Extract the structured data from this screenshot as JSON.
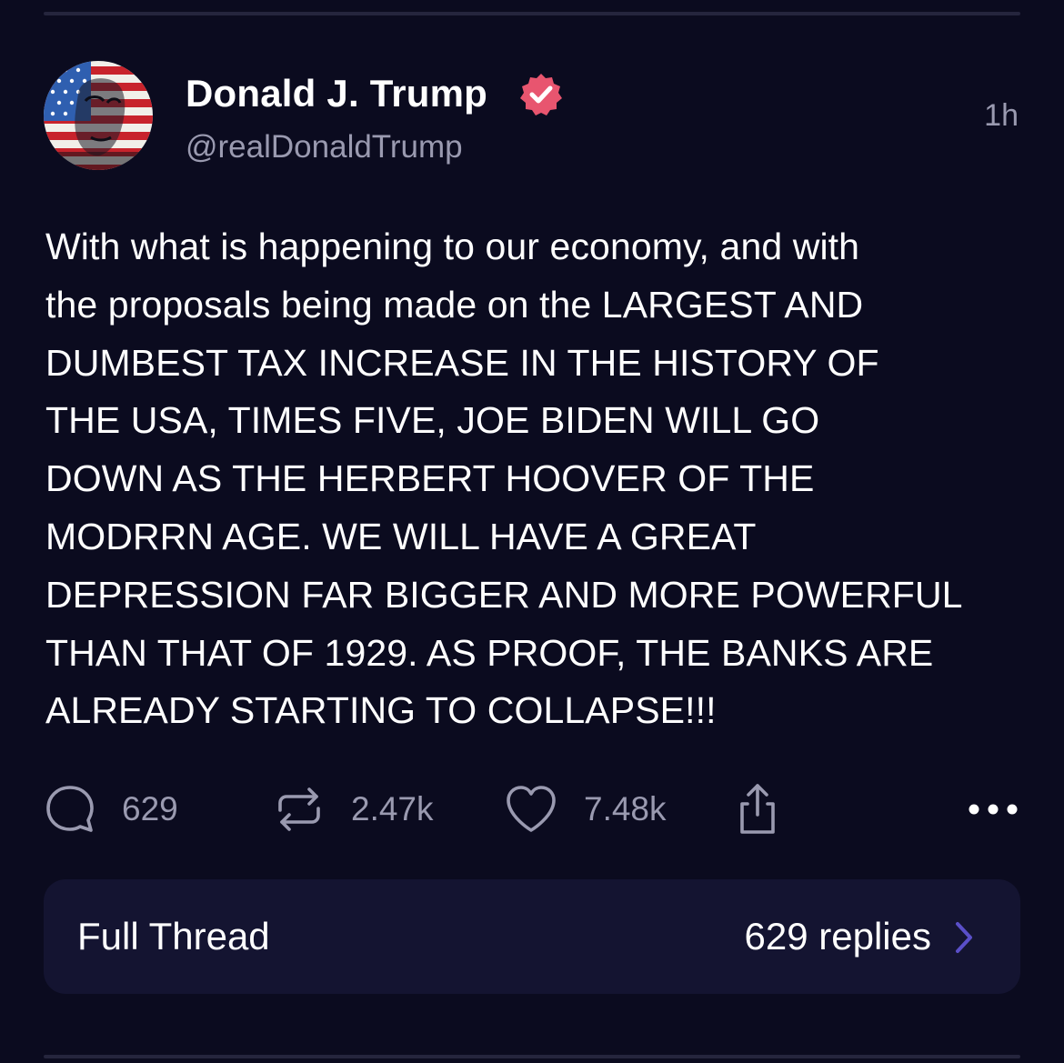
{
  "post": {
    "author": {
      "display_name": "Donald J. Trump",
      "handle": "@realDonaldTrump",
      "verified": true,
      "avatar_icon": "avatar-flag-portrait"
    },
    "timestamp": "1h",
    "text": "With what is happening to our economy, and with\nthe proposals being made on the LARGEST AND\nDUMBEST TAX INCREASE IN THE HISTORY OF\nTHE USA, TIMES FIVE, JOE BIDEN WILL GO\nDOWN AS THE HERBERT HOOVER OF THE\nMODRRN AGE. WE WILL HAVE A GREAT\nDEPRESSION FAR BIGGER AND MORE POWERFUL\nTHAN THAT OF 1929. AS PROOF, THE BANKS ARE\nALREADY STARTING TO COLLAPSE!!!",
    "actions": {
      "reply": {
        "icon": "comment-icon",
        "count": "629"
      },
      "repost": {
        "icon": "repost-icon",
        "count": "2.47k"
      },
      "like": {
        "icon": "heart-icon",
        "count": "7.48k"
      },
      "share": {
        "icon": "share-icon"
      },
      "more": {
        "icon": "more-icon"
      }
    }
  },
  "thread": {
    "label": "Full Thread",
    "replies": "629 replies",
    "chevron_icon": "chevron-right-icon"
  },
  "colors": {
    "background": "#0b0b1f",
    "card": "#141431",
    "muted_text": "#9a9ab0",
    "verified_badge": "#e8556f",
    "chevron": "#5a4fc8"
  }
}
